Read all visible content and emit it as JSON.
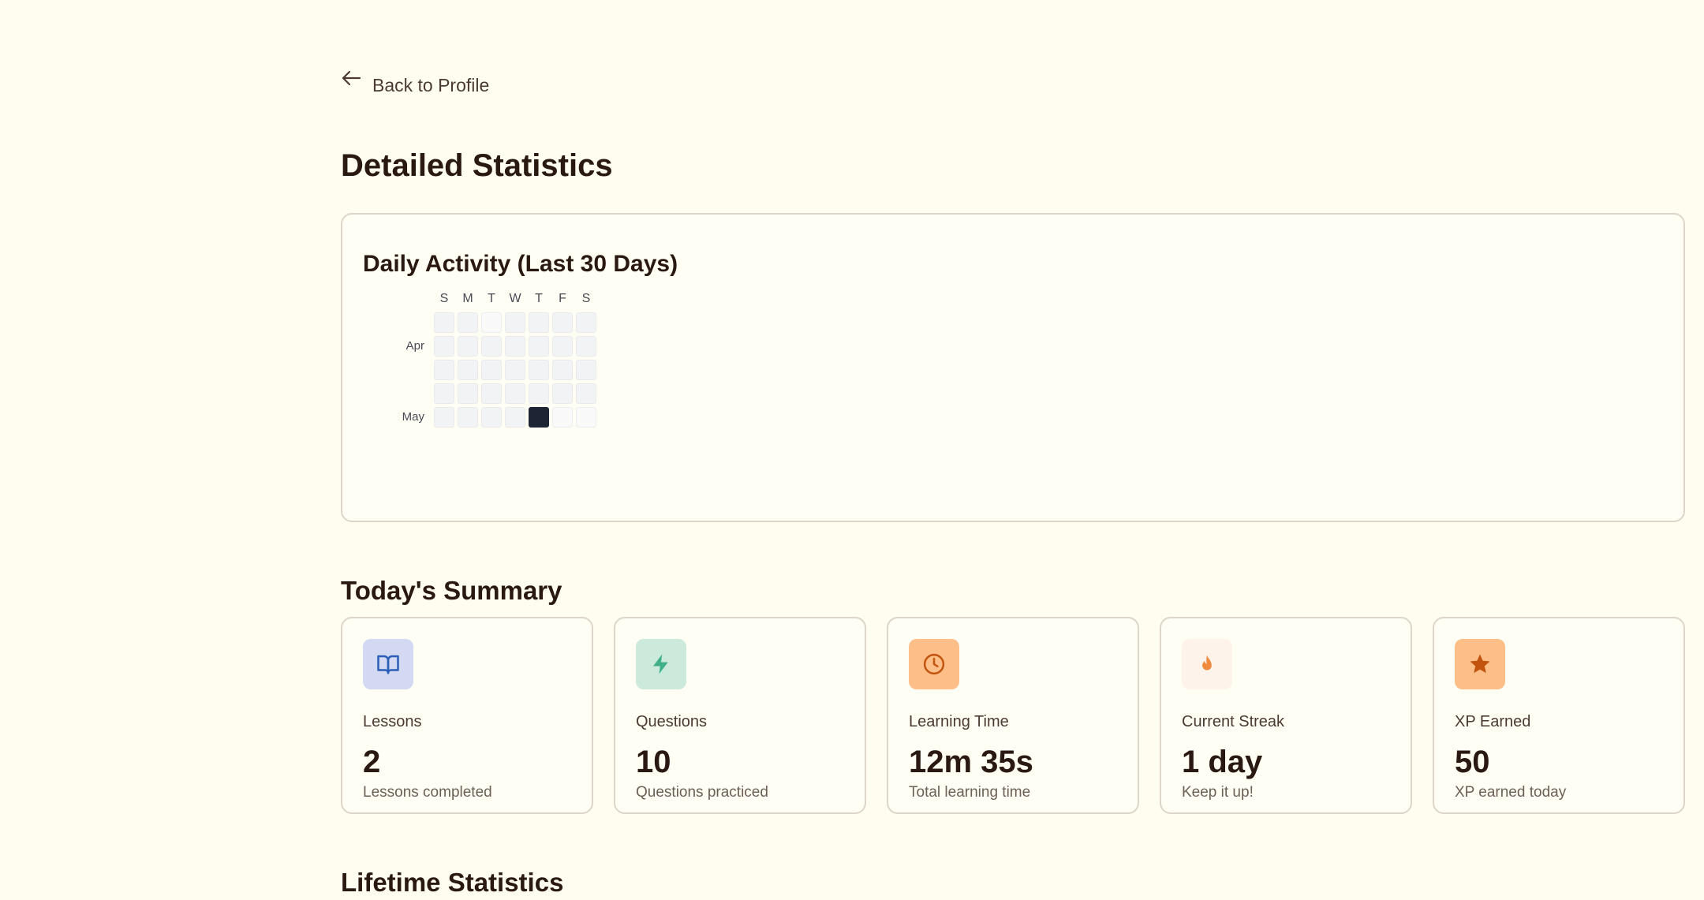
{
  "nav": {
    "back_label": "Back to Profile"
  },
  "page": {
    "title": "Detailed Statistics"
  },
  "activity": {
    "title": "Daily Activity (Last 30 Days)",
    "weekdays": [
      "S",
      "M",
      "T",
      "W",
      "T",
      "F",
      "S"
    ],
    "months": [
      {
        "label": "Apr",
        "row": 1
      },
      {
        "label": "May",
        "row": 4
      }
    ],
    "grid": [
      [
        "empty",
        "empty",
        "future",
        "empty",
        "empty",
        "empty",
        "empty"
      ],
      [
        "empty",
        "empty",
        "empty",
        "empty",
        "empty",
        "empty",
        "empty"
      ],
      [
        "empty",
        "empty",
        "empty",
        "empty",
        "empty",
        "empty",
        "empty"
      ],
      [
        "empty",
        "empty",
        "empty",
        "empty",
        "empty",
        "empty",
        "empty"
      ],
      [
        "empty",
        "empty",
        "empty",
        "empty",
        "active",
        "future",
        "future"
      ]
    ],
    "colors": {
      "empty": "#f2f3f4",
      "future": "#f8f9f8",
      "active": "#1d2433"
    }
  },
  "summary": {
    "title": "Today's Summary",
    "cards": [
      {
        "icon": "book-icon",
        "label": "Lessons",
        "value": "2",
        "sub": "Lessons completed",
        "icon_bg": "#d3d8f3",
        "icon_color": "#2a5fb8"
      },
      {
        "icon": "lightning-icon",
        "label": "Questions",
        "value": "10",
        "sub": "Questions practiced",
        "icon_bg": "#cceadb",
        "icon_color": "#3fb08a"
      },
      {
        "icon": "clock-icon",
        "label": "Learning Time",
        "value": "12m 35s",
        "sub": "Total learning time",
        "icon_bg": "#fdbf87",
        "icon_color": "#c2540f"
      },
      {
        "icon": "flame-icon",
        "label": "Current Streak",
        "value": "1 day",
        "sub": "Keep it up!",
        "icon_bg": "#fdf3ea",
        "icon_color": "#f08a3c"
      },
      {
        "icon": "star-icon",
        "label": "XP Earned",
        "value": "50",
        "sub": "XP earned today",
        "icon_bg": "#fdbf87",
        "icon_color": "#c2540f"
      }
    ]
  },
  "lifetime": {
    "title": "Lifetime Statistics"
  }
}
